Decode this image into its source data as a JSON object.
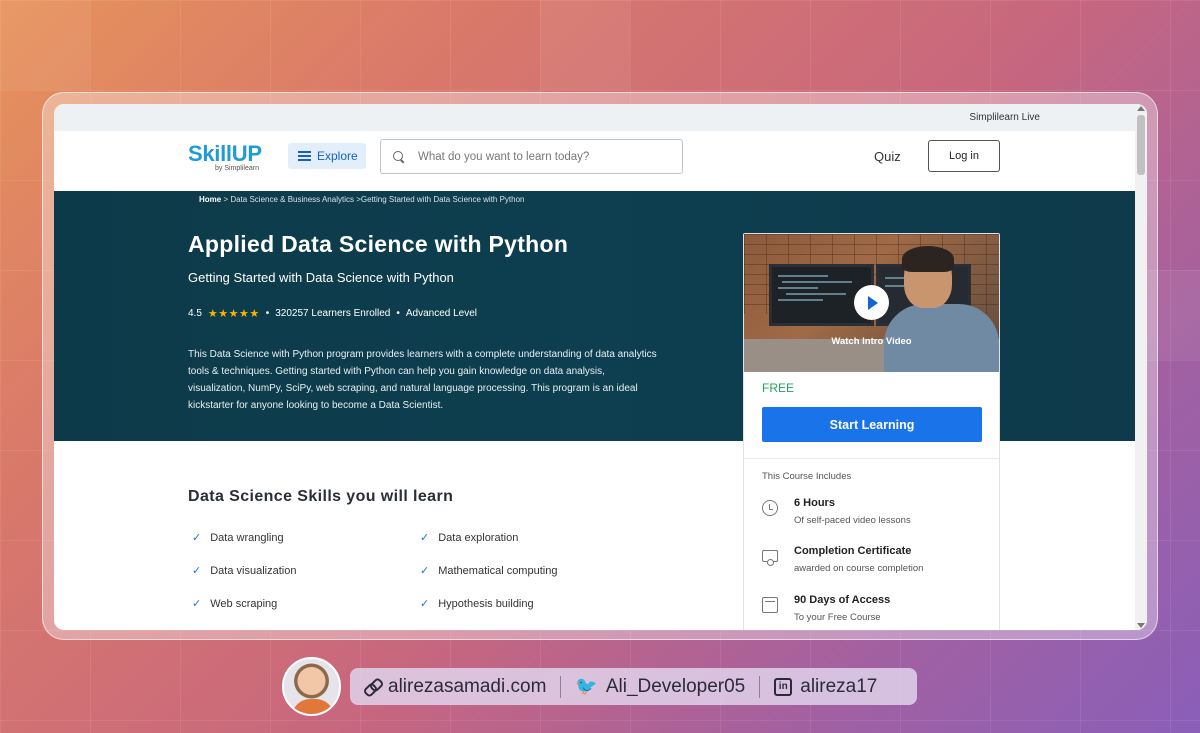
{
  "topbar": {
    "live_label": "Simplilearn Live"
  },
  "nav": {
    "logo_brand": "SkillUP",
    "logo_by": "by Simplilearn",
    "explore_label": "Explore",
    "search_placeholder": "What do you want to learn today?",
    "quiz_label": "Quiz",
    "login_label": "Log in"
  },
  "breadcrumb": {
    "home": "Home",
    "rest": " > Data Science & Business Analytics >Getting Started with Data Science with Python"
  },
  "course": {
    "title": "Applied Data Science with Python",
    "subtitle": "Getting Started with Data Science with Python",
    "rating": "4.5",
    "stars": "★★★★★",
    "enrolled": "320257 Learners Enrolled",
    "level": "Advanced Level",
    "description": "This Data Science with Python program provides learners with a complete understanding of data analytics tools & techniques. Getting started with Python can help you gain knowledge on data analysis, visualization, NumPy, SciPy, web scraping, and natural language processing. This program is an ideal kickstarter for anyone looking to become a Data Scientist."
  },
  "card": {
    "video_label": "Watch Intro Video",
    "price": "FREE",
    "cta": "Start Learning",
    "includes_title": "This Course Includes",
    "includes": [
      {
        "title": "6 Hours",
        "sub": "Of self-paced video lessons",
        "icon": "clock-icon"
      },
      {
        "title": "Completion Certificate",
        "sub": "awarded on course completion",
        "icon": "certificate-icon"
      },
      {
        "title": "90 Days of Access",
        "sub": "To your Free Course",
        "icon": "calendar-icon"
      }
    ]
  },
  "skills": {
    "heading": "Data Science Skills you will learn",
    "items": [
      "Data wrangling",
      "Data exploration",
      "Data visualization",
      "Mathematical computing",
      "Web scraping",
      "Hypothesis building"
    ]
  },
  "footer": {
    "website": "alirezasamadi.com",
    "twitter": "Ali_Developer05",
    "linkedin": "alireza17",
    "linkedin_glyph": "in"
  },
  "colors": {
    "accent": "#1a73e8",
    "hero": "#0d3f50",
    "free": "#23a455",
    "stars": "#f7b500"
  }
}
